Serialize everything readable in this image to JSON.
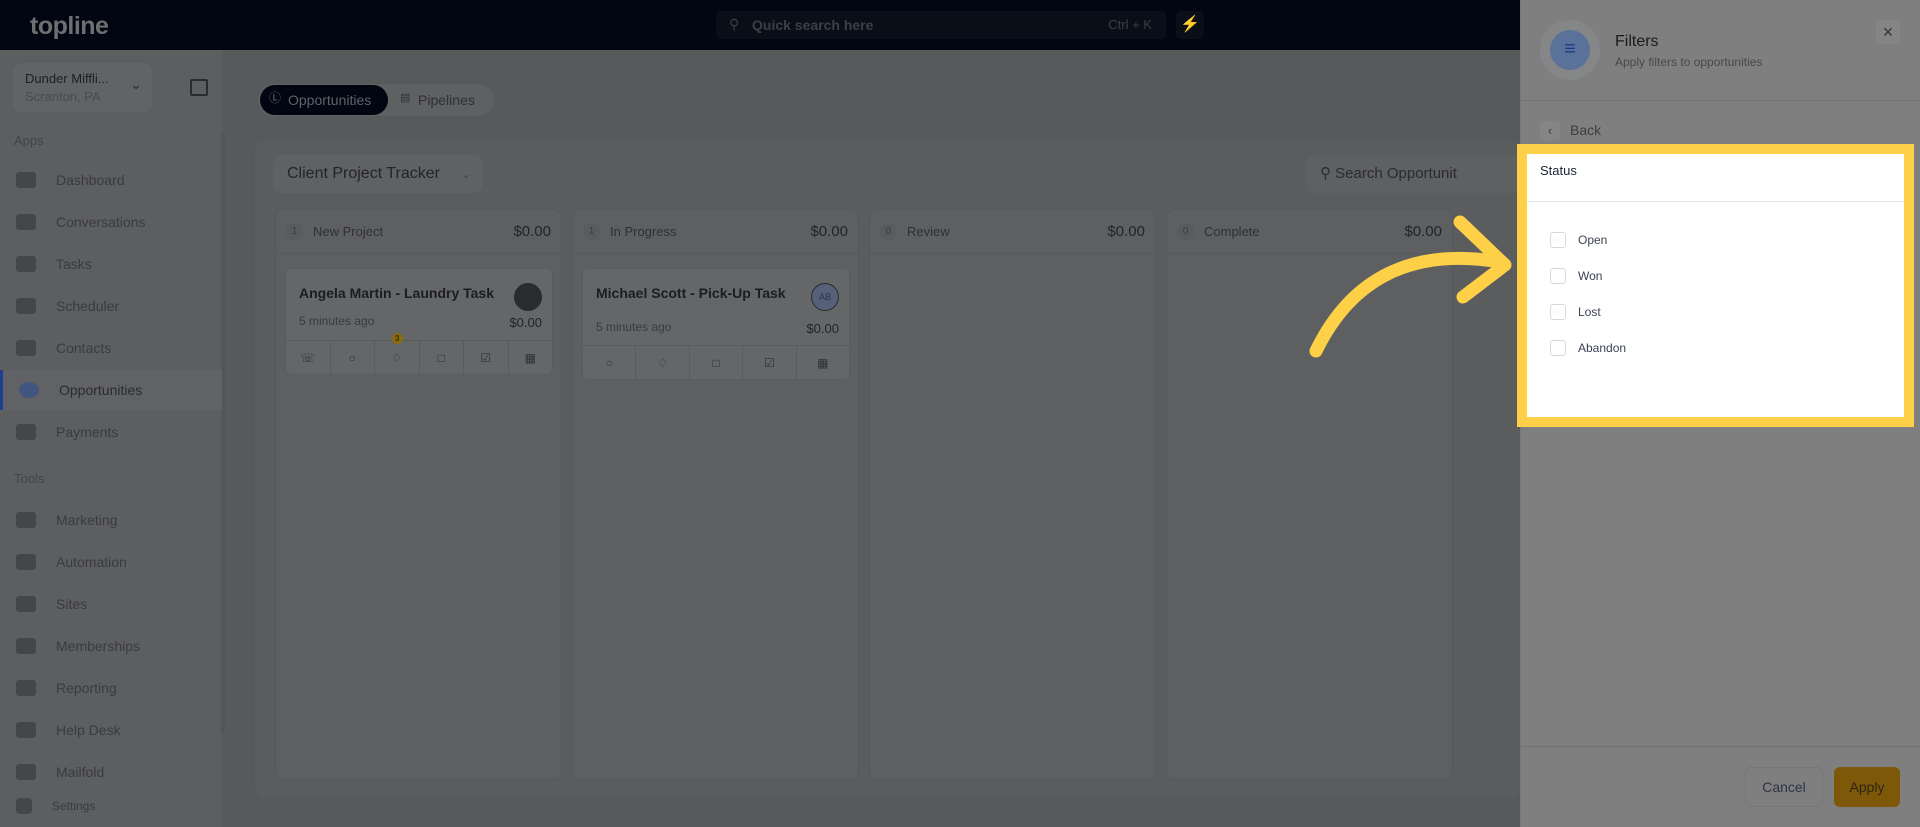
{
  "topbar": {
    "logo": "topline",
    "search_placeholder": "Quick search here",
    "search_shortcut": "Ctrl + K",
    "quick_action_icon": "bolt-icon"
  },
  "sidebar": {
    "org_name": "Dunder Miffli...",
    "org_location": "Scranton, PA",
    "apps_label": "Apps",
    "apps": [
      {
        "label": "Dashboard",
        "icon": "dashboard-icon"
      },
      {
        "label": "Conversations",
        "icon": "chat-icon"
      },
      {
        "label": "Tasks",
        "icon": "task-icon"
      },
      {
        "label": "Scheduler",
        "icon": "calendar-icon"
      },
      {
        "label": "Contacts",
        "icon": "user-icon"
      },
      {
        "label": "Opportunities",
        "icon": "target-icon",
        "active": true
      },
      {
        "label": "Payments",
        "icon": "card-icon"
      }
    ],
    "tools_label": "Tools",
    "tools": [
      {
        "label": "Marketing",
        "icon": "megaphone-icon"
      },
      {
        "label": "Automation",
        "icon": "gears-icon"
      },
      {
        "label": "Sites",
        "icon": "globe-icon"
      },
      {
        "label": "Memberships",
        "icon": "users-icon"
      },
      {
        "label": "Reporting",
        "icon": "pie-chart-icon"
      },
      {
        "label": "Help Desk",
        "icon": "help-icon"
      },
      {
        "label": "Mailfold",
        "icon": "mail-icon"
      }
    ],
    "settings": "Settings"
  },
  "tabs": [
    {
      "label": "Opportunities",
      "active": true
    },
    {
      "label": "Pipelines"
    }
  ],
  "board": {
    "pipeline": "Client Project Tracker",
    "search_placeholder": "Search Opportunit",
    "columns": [
      {
        "count": "1",
        "name": "New Project",
        "amount": "$0.00",
        "cards": [
          {
            "title": "Angela Martin - Laundry Task",
            "time": "5 minutes ago",
            "value": "$0.00",
            "tag_badge": "3"
          }
        ]
      },
      {
        "count": "1",
        "name": "In Progress",
        "amount": "$0.00",
        "cards": [
          {
            "title": "Michael Scott - Pick-Up Task",
            "time": "5 minutes ago",
            "value": "$0.00",
            "avatar": "AB"
          }
        ]
      },
      {
        "count": "0",
        "name": "Review",
        "amount": "$0.00",
        "cards": []
      },
      {
        "count": "0",
        "name": "Complete",
        "amount": "$0.00",
        "cards": []
      }
    ]
  },
  "filters": {
    "title": "Filters",
    "subtitle": "Apply filters to opportunities",
    "back": "Back",
    "section": "Status",
    "options": [
      {
        "label": "Open",
        "checked": false
      },
      {
        "label": "Won",
        "checked": false
      },
      {
        "label": "Lost",
        "checked": false
      },
      {
        "label": "Abandon",
        "checked": false
      }
    ],
    "cancel": "Cancel",
    "apply": "Apply"
  },
  "colors": {
    "highlight": "#fdd048",
    "apply": "#e0a10f",
    "active_nav": "#2453c8"
  }
}
